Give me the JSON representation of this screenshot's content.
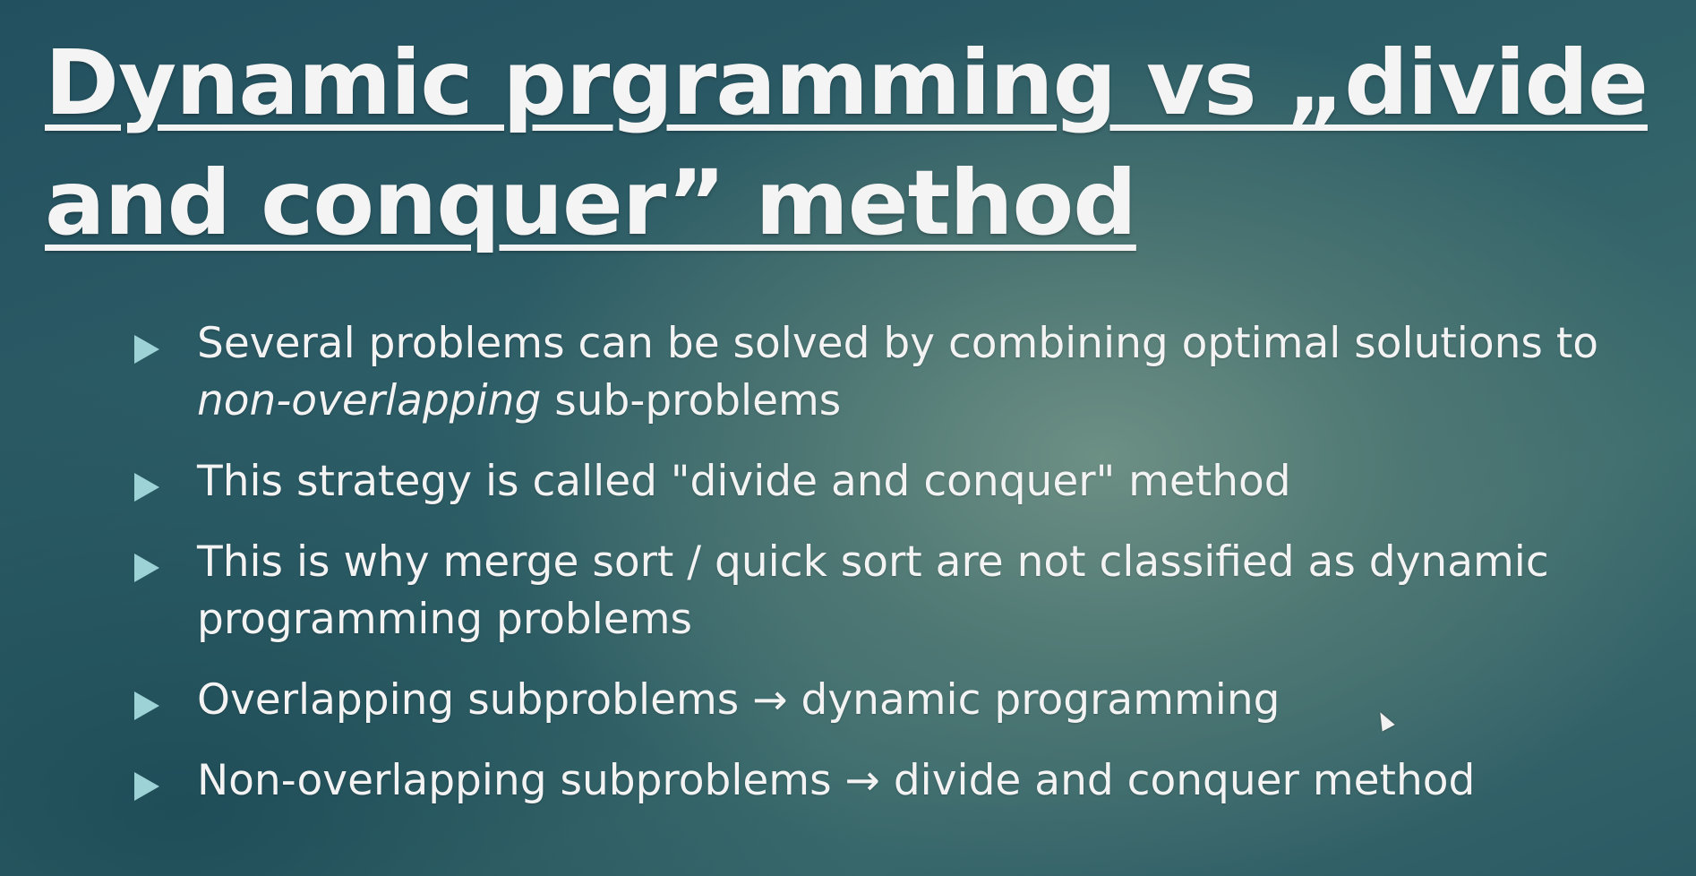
{
  "slide": {
    "title_line1": "Dynamic prgramming vs „divide",
    "title_line2": "and conquer” method",
    "bullets": [
      {
        "prefix": "Several problems can be solved by combining optimal solutions to ",
        "emphasis": "non-overlapping",
        "suffix": " sub-problems"
      },
      {
        "text": "This strategy is called \"divide and conquer\" method"
      },
      {
        "text": "This is why merge sort / quick sort are not classified as dynamic programming problems"
      },
      {
        "text": "Overlapping subproblems → dynamic programming"
      },
      {
        "text": "Non-overlapping subproblems → divide and conquer method"
      }
    ]
  },
  "colors": {
    "background_dark": "#23505f",
    "background_light": "#709286",
    "bullet_arrow": "#9dd3d6",
    "text": "#f3f3f3"
  },
  "icons": {
    "bullet": "right-triangle-icon",
    "cursor": "mouse-pointer-icon"
  }
}
